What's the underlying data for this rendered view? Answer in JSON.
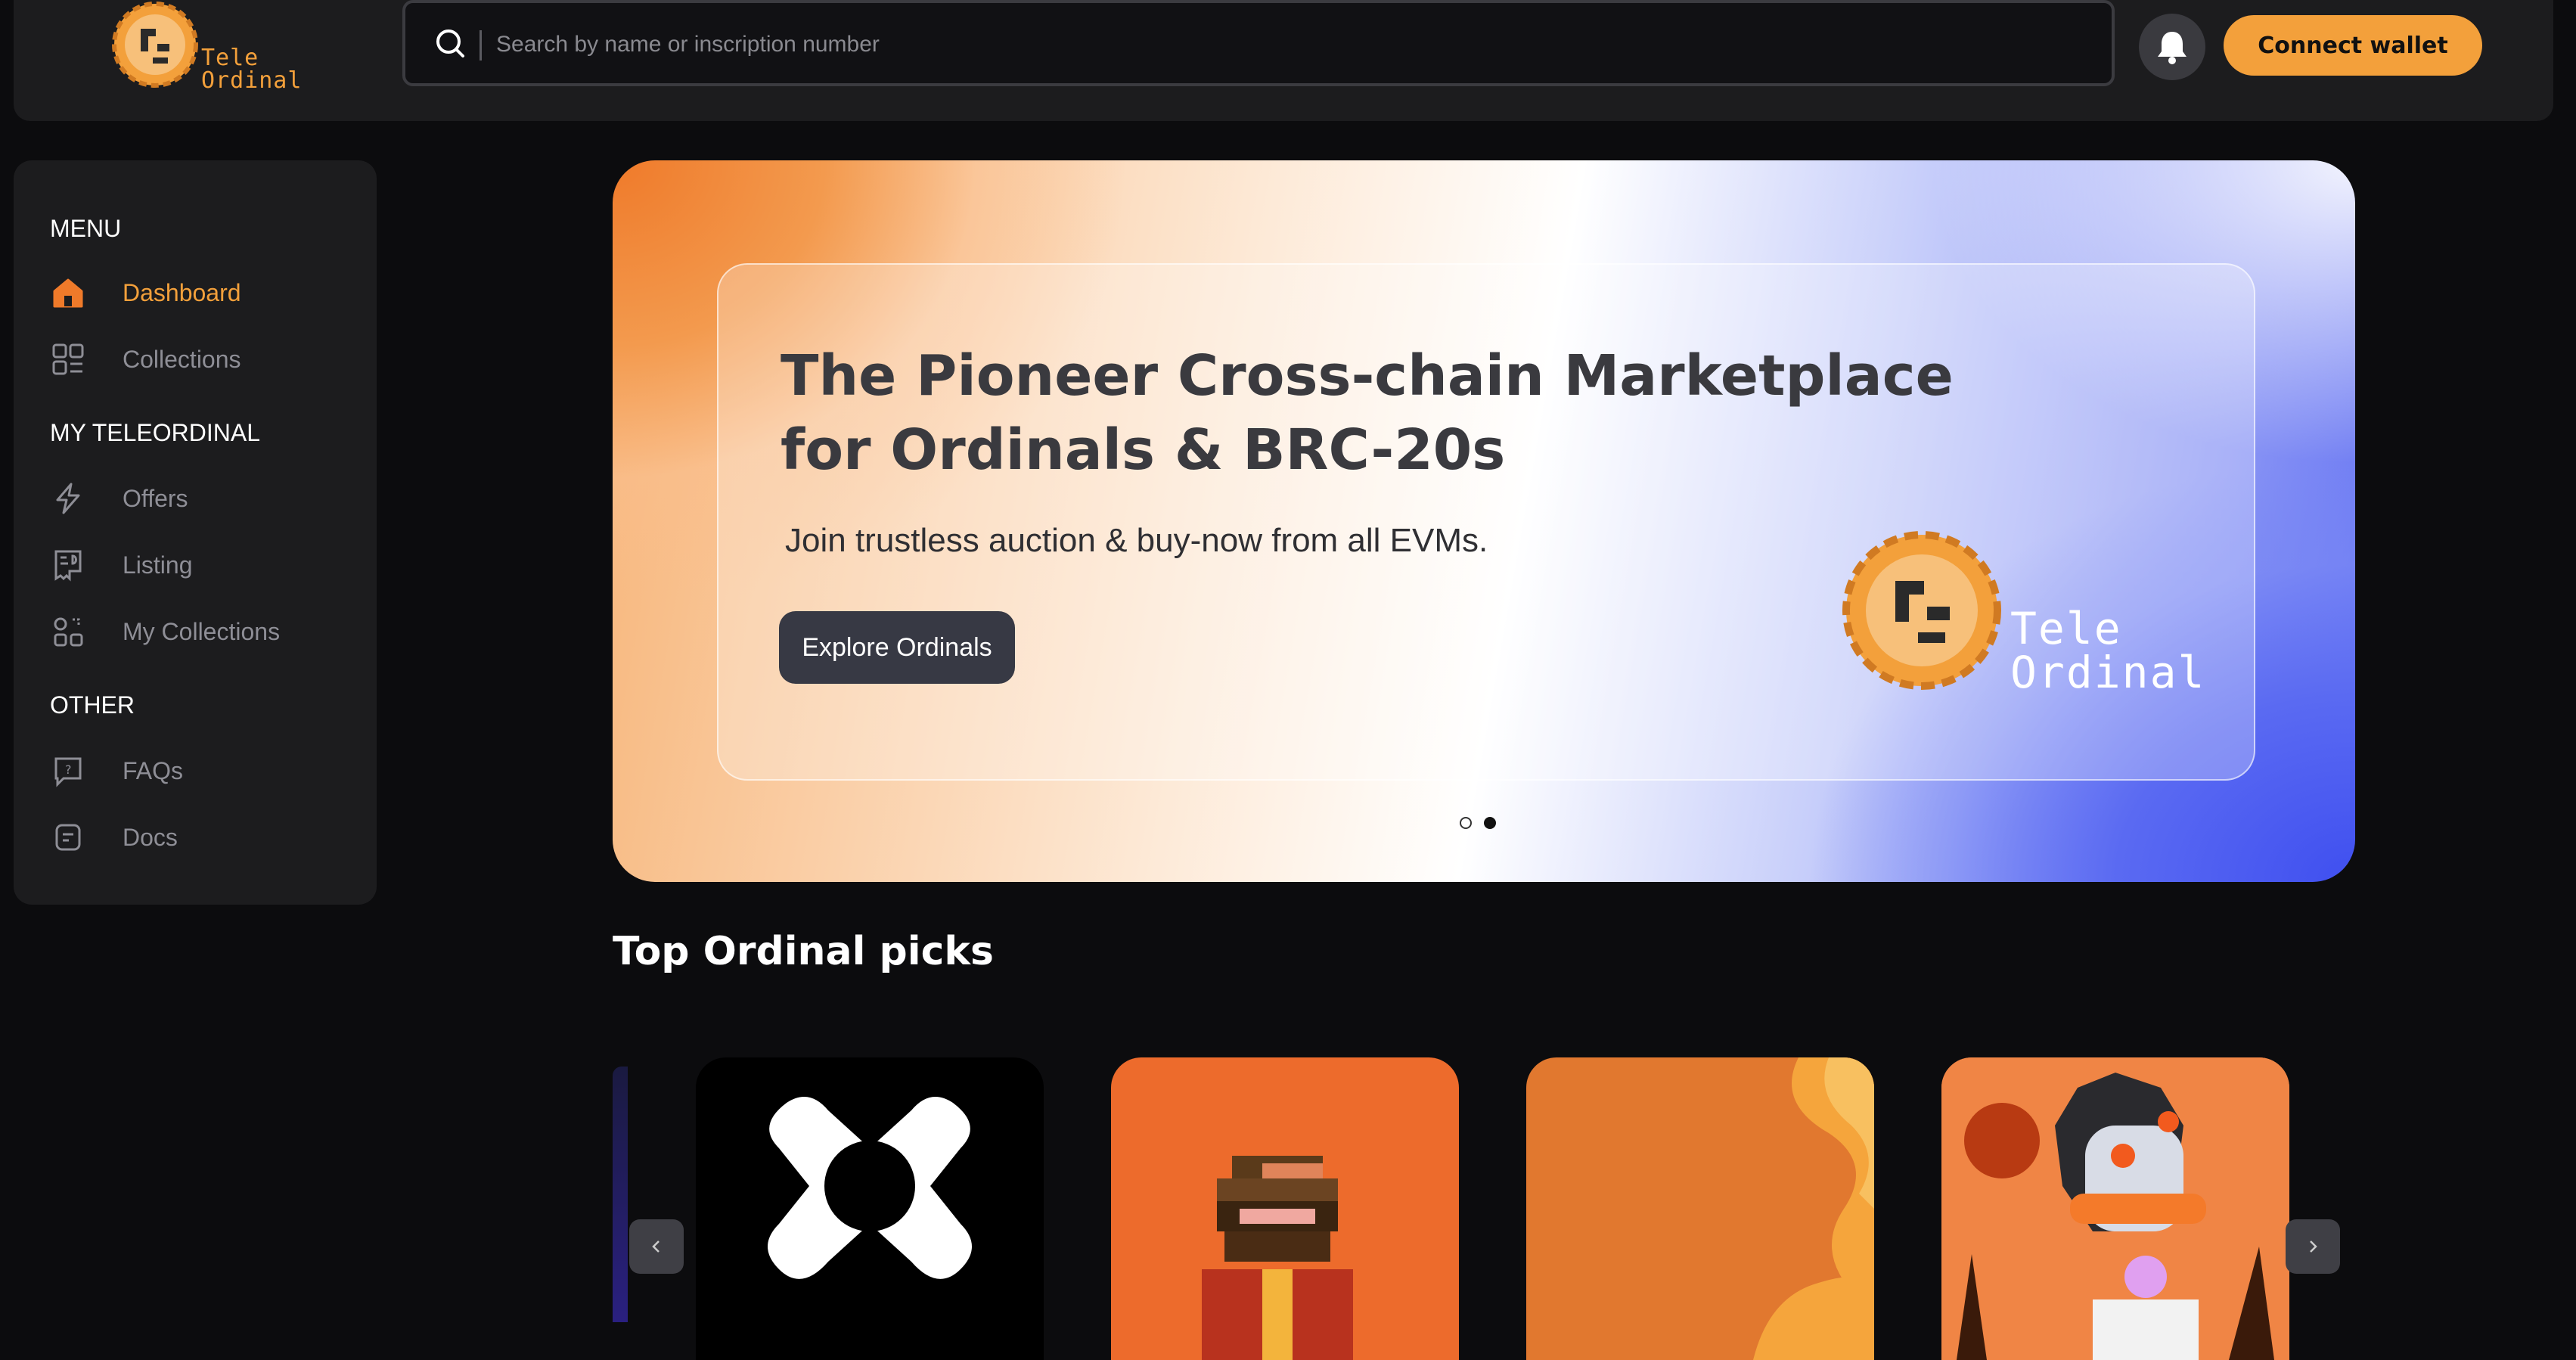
{
  "header": {
    "logo_line1": "Tele",
    "logo_line2": "Ordinal",
    "search_placeholder": "Search by name or inscription number",
    "notifications_icon": "bell-icon",
    "connect_label": "Connect wallet"
  },
  "sidebar": {
    "sections": [
      {
        "title": "MENU",
        "items": [
          {
            "label": "Dashboard",
            "icon": "home-icon",
            "active": true
          },
          {
            "label": "Collections",
            "icon": "grid-icon"
          }
        ]
      },
      {
        "title": "MY TELEORDINAL",
        "items": [
          {
            "label": "Offers",
            "icon": "lightning-icon"
          },
          {
            "label": "Listing",
            "icon": "receipt-icon"
          },
          {
            "label": "My Collections",
            "icon": "shapes-icon"
          }
        ]
      },
      {
        "title": "OTHER",
        "items": [
          {
            "label": "FAQs",
            "icon": "chat-question-icon"
          },
          {
            "label": "Docs",
            "icon": "doc-icon"
          }
        ]
      }
    ]
  },
  "hero": {
    "title": "The Pioneer Cross-chain Marketplace for Ordinals & BRC-20s",
    "subtitle": "Join trustless auction & buy-now from all EVMs.",
    "cta_label": "Explore Ordinals",
    "logo_line1": "Tele",
    "logo_line2": "Ordinal",
    "slides_total": 2,
    "active_slide": 2
  },
  "picks": {
    "title": "Top Ordinal picks"
  },
  "colors": {
    "accent": "#f3a03b",
    "background": "#0c0c0e",
    "panel": "#1c1c1e"
  }
}
